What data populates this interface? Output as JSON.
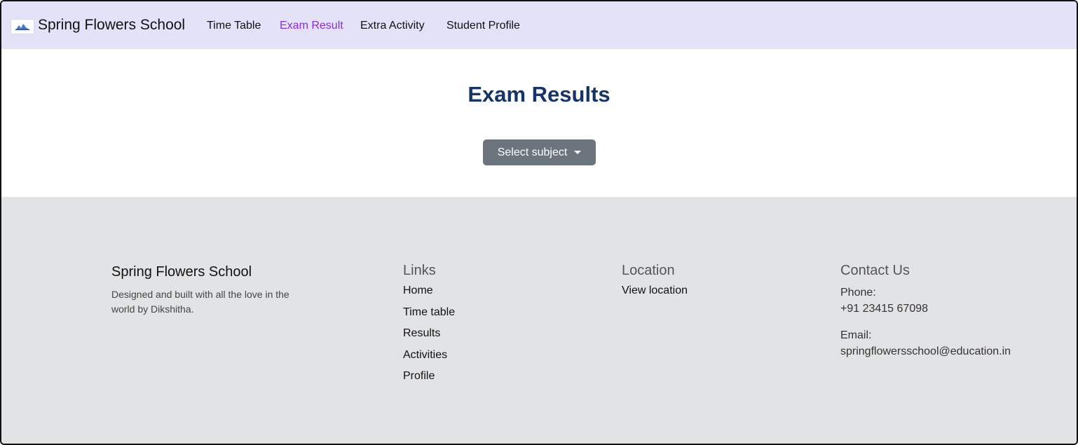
{
  "navbar": {
    "brand": "Spring Flowers School",
    "links": [
      "Time Table",
      "Exam Result",
      "Extra Activity",
      "Student Profile"
    ],
    "active_link": "Exam Result",
    "logo_icon": "school-logo-icon"
  },
  "main": {
    "title": "Exam Results",
    "select_label": "Select subject"
  },
  "footer": {
    "brand": "Spring Flowers School",
    "description": "Designed and built with all the love in the world by Dikshitha.",
    "links_heading": "Links",
    "links": [
      "Home",
      "Time table",
      "Results",
      "Activities",
      "Profile"
    ],
    "location_heading": "Location",
    "location_link": "View location",
    "contact_heading": "Contact Us",
    "phone_label": "Phone:",
    "phone": "+91 23415 67098",
    "email_label": "Email:",
    "email": "springflowersschool@education.in"
  },
  "colors": {
    "navbar_bg": "#e3e2f9",
    "active_link": "#8a2be2",
    "title": "#15346a",
    "button": "#6c757d",
    "footer_bg": "#e2e3e5"
  }
}
